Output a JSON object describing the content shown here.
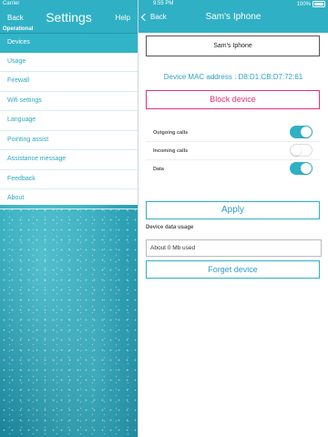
{
  "status_bar": {
    "carrier": "Carrier",
    "time": "9:55 PM",
    "battery": "100%"
  },
  "settings_panel": {
    "back_label": "Back",
    "title": "Settings",
    "help_label": "Help",
    "section_label": "Operational",
    "items": [
      {
        "label": "Devices",
        "active": true
      },
      {
        "label": "Usage"
      },
      {
        "label": "Firewall"
      },
      {
        "label": "Wifi settings"
      },
      {
        "label": "Language"
      },
      {
        "label": "Pointing assist"
      },
      {
        "label": "Assistance message"
      },
      {
        "label": "Feedback"
      },
      {
        "label": "About"
      }
    ]
  },
  "device_panel": {
    "back_label": "Back",
    "title": "Sam's Iphone",
    "device_name": "Sam's Iphone",
    "mac_line": "Device MAC address : D8:D1:CB:D7:72:61",
    "block_label": "Block device",
    "toggles": [
      {
        "label": "Outgoing calls",
        "on": true
      },
      {
        "label": "Incoming calls",
        "on": false
      },
      {
        "label": "Data",
        "on": true
      }
    ],
    "apply_label": "Apply",
    "usage_label": "Device data usage",
    "usage_value": "About 0 Mb used",
    "forget_label": "Forget device"
  },
  "colors": {
    "accent": "#2fb0c4",
    "link": "#2f9fc7",
    "danger": "#e0337a"
  }
}
